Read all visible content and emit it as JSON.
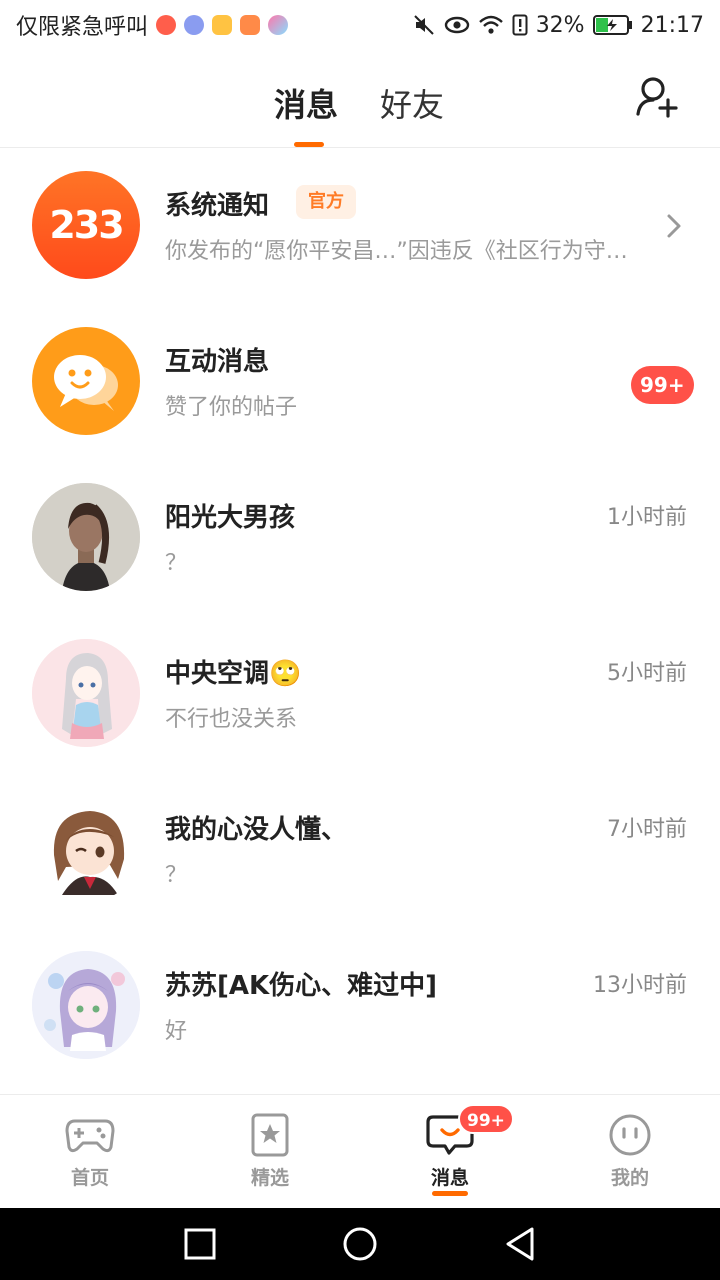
{
  "status_bar": {
    "carrier": "仅限紧急呼叫",
    "battery": "32%",
    "time": "21:17"
  },
  "header": {
    "tabs": [
      {
        "label": "消息",
        "active": true
      },
      {
        "label": "好友",
        "active": false
      }
    ],
    "add_friend_icon": "add-user-icon"
  },
  "messages": [
    {
      "name": "系统通知",
      "tag": "官方",
      "preview": "你发布的“愿你平安昌…”因违反《社区行为守…",
      "avatar_text": "233"
    },
    {
      "name": "互动消息",
      "preview": "赞了你的帖子",
      "badge": "99+"
    },
    {
      "name": "阳光大男孩",
      "preview": "？",
      "time": "1小时前"
    },
    {
      "name": "中央空调🙄",
      "preview": "不行也没关系",
      "time": "5小时前"
    },
    {
      "name": "我的心没人懂、",
      "preview": "？",
      "time": "7小时前"
    },
    {
      "name": "苏苏[AK伤心、难过中]",
      "preview": "好",
      "time": "13小时前"
    }
  ],
  "bottom_nav": {
    "items": [
      {
        "label": "首页",
        "icon": "gamepad-icon"
      },
      {
        "label": "精选",
        "icon": "star-card-icon"
      },
      {
        "label": "消息",
        "icon": "chat-bubble-icon",
        "badge": "99+",
        "active": true
      },
      {
        "label": "我的",
        "icon": "face-icon"
      }
    ]
  },
  "colors": {
    "accent": "#ff6a00",
    "badge": "#ff5148",
    "text_secondary": "#9a9a9a"
  }
}
